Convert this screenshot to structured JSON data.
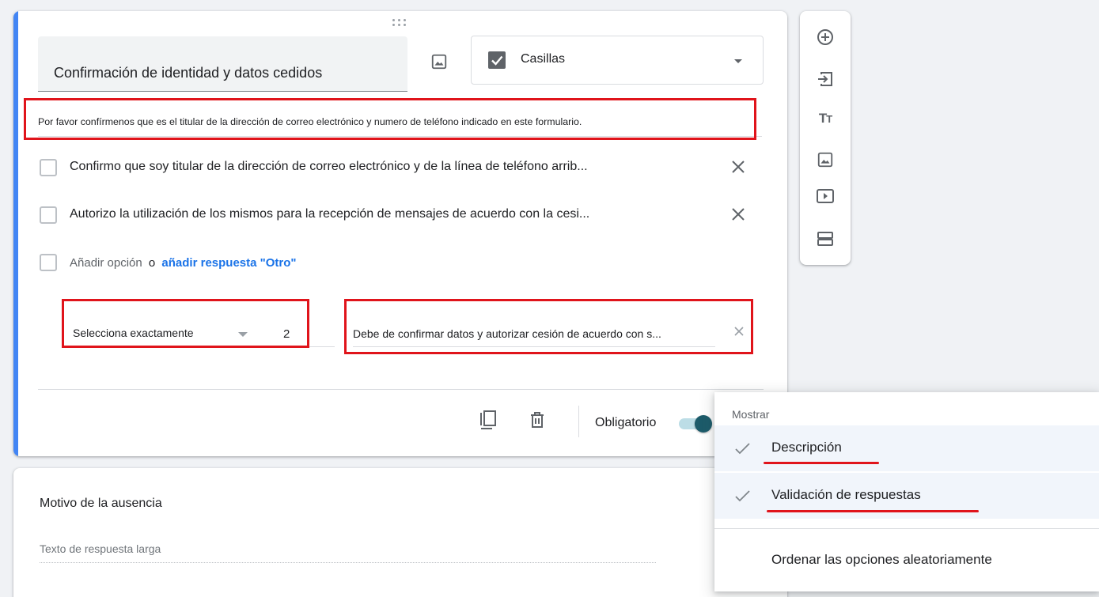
{
  "question": {
    "title": "Confirmación de identidad y datos cedidos",
    "type_label": "Casillas",
    "description": "Por favor confírmenos que es el titular de la dirección de correo electrónico y numero de teléfono indicado en este formulario.",
    "options": [
      {
        "label": "Confirmo que soy titular de la dirección de correo electrónico y de la línea de teléfono arrib..."
      },
      {
        "label": "Autorizo la utilización de los mismos para la recepción de mensajes de acuerdo con la cesi..."
      }
    ],
    "add_option_label": "Añadir opción",
    "or_label": "o",
    "add_other_label": "añadir respuesta \"Otro\"",
    "validation": {
      "type": "Selecciona exactamente",
      "number": "2",
      "error_text": "Debe de confirmar datos y autorizar cesión de acuerdo con s..."
    },
    "required_label": "Obligatorio",
    "required": true
  },
  "toolbar": {
    "items": [
      "add-question-icon",
      "import-questions-icon",
      "add-title-icon",
      "add-image-icon",
      "add-video-icon",
      "add-section-icon"
    ]
  },
  "next_question": {
    "title": "Motivo de la ausencia",
    "answer_placeholder": "Texto de respuesta larga"
  },
  "menu": {
    "header": "Mostrar",
    "items": [
      {
        "label": "Descripción",
        "checked": true
      },
      {
        "label": "Validación de respuestas",
        "checked": true
      },
      {
        "label": "Ordenar las opciones aleatoriamente",
        "checked": false
      }
    ]
  },
  "colors": {
    "accent": "#4285f4",
    "annotation_red": "#e0141b",
    "link_blue": "#1a73e8",
    "toggle_on": "#1c5b6a"
  }
}
